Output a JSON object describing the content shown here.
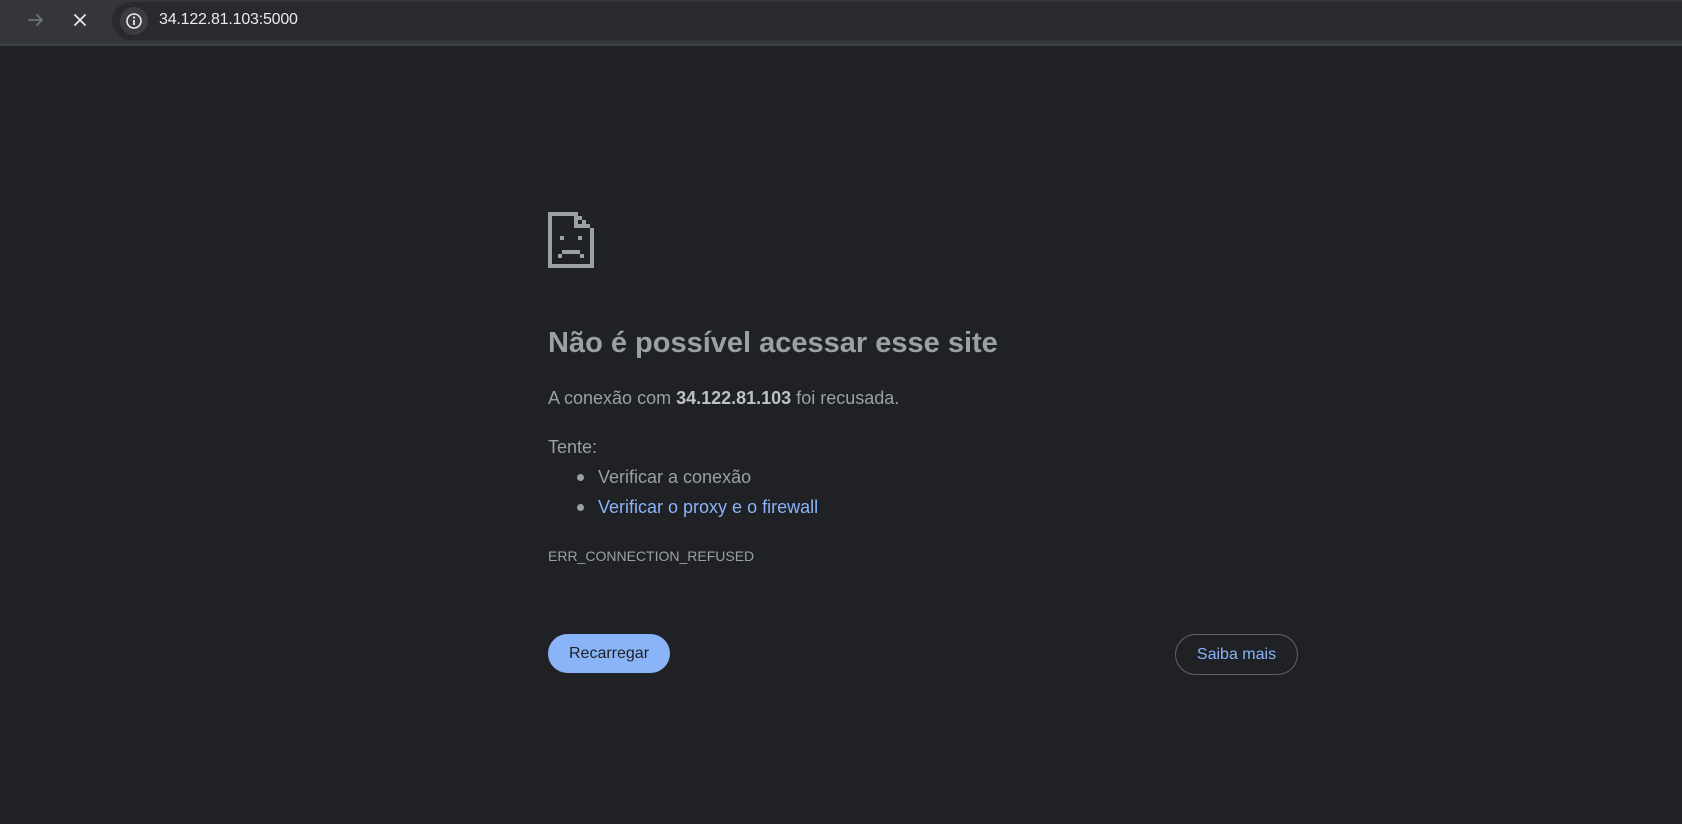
{
  "browser": {
    "url": "34.122.81.103:5000",
    "icons": {
      "forward": "arrow-right-icon",
      "stop": "close-icon",
      "site_info": "info-icon"
    }
  },
  "error_page": {
    "icon": "sad-page-icon",
    "title": "Não é possível acessar esse site",
    "description_prefix": "A conexão com ",
    "host": "34.122.81.103",
    "description_suffix": " foi recusada.",
    "try_label": "Tente:",
    "suggestions": [
      {
        "label": "Verificar a conexão",
        "is_link": false
      },
      {
        "label": "Verificar o proxy e o firewall",
        "is_link": true
      }
    ],
    "error_code": "ERR_CONNECTION_REFUSED",
    "reload_label": "Recarregar",
    "learn_more_label": "Saiba mais"
  },
  "colors": {
    "background": "#202124",
    "text": "#9aa0a6",
    "link": "#8ab4f8",
    "button_primary": "#8ab4f8"
  }
}
